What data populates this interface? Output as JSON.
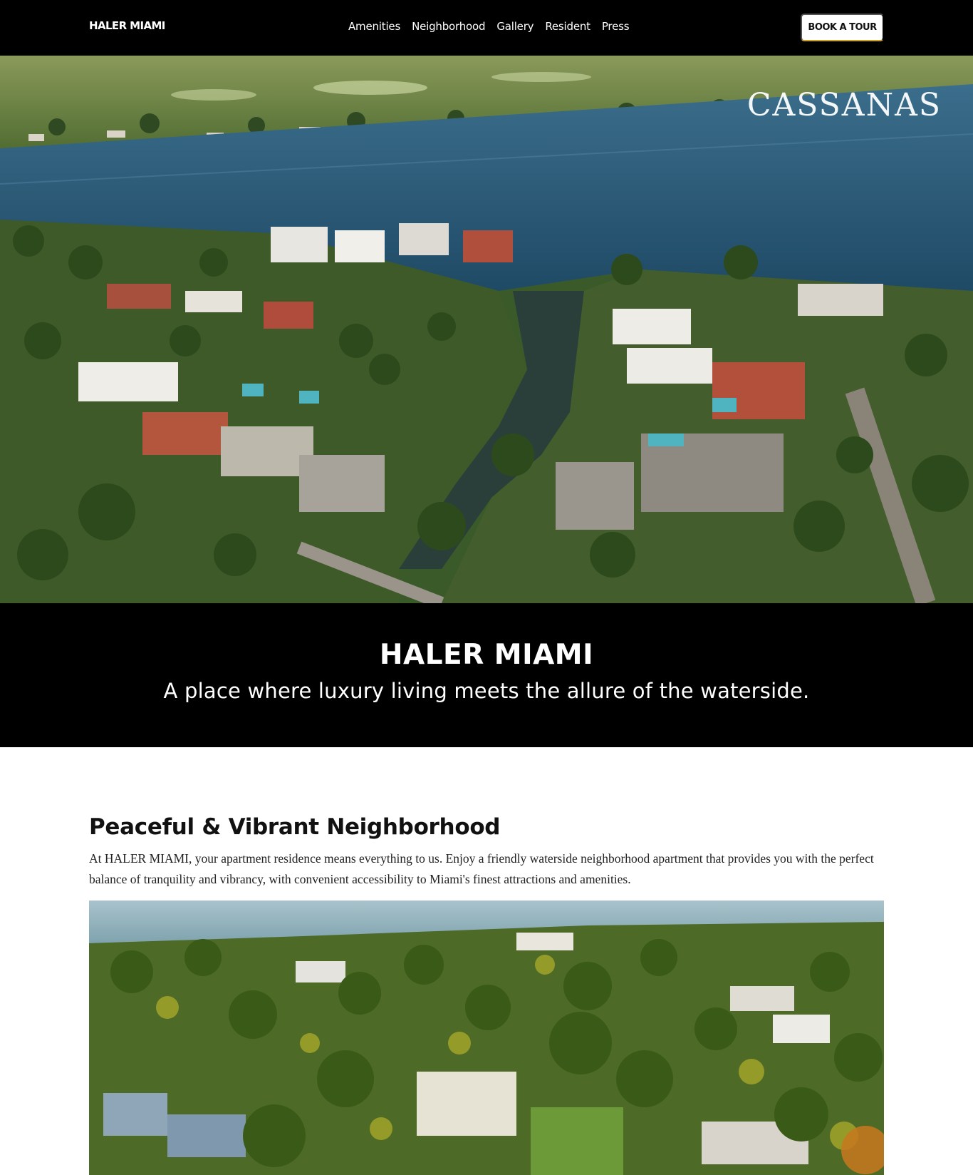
{
  "navbar": {
    "brand": "HALER MIAMI",
    "links": [
      "Amenities",
      "Neighborhood",
      "Gallery",
      "Resident",
      "Press"
    ],
    "cta_label": "BOOK A TOUR"
  },
  "hero": {
    "logo_text": "CASSANAS"
  },
  "banner": {
    "title": "HALER MIAMI",
    "subtitle": "A place where luxury living meets the allure of the waterside."
  },
  "neighborhood": {
    "title": "Peaceful & Vibrant Neighborhood",
    "text": "At HALER MIAMI, your apartment residence means everything to us. Enjoy a friendly waterside neighborhood apartment that provides you with the perfect balance of tranquility and vibrancy, with convenient accessibility to Miami's finest attractions and amenities."
  },
  "colors": {
    "nav_bg": "#000000",
    "banner_bg": "#000000",
    "cta_bg": "#ffffff",
    "cta_accent": "#c9a227",
    "water": "#2e5f80"
  }
}
